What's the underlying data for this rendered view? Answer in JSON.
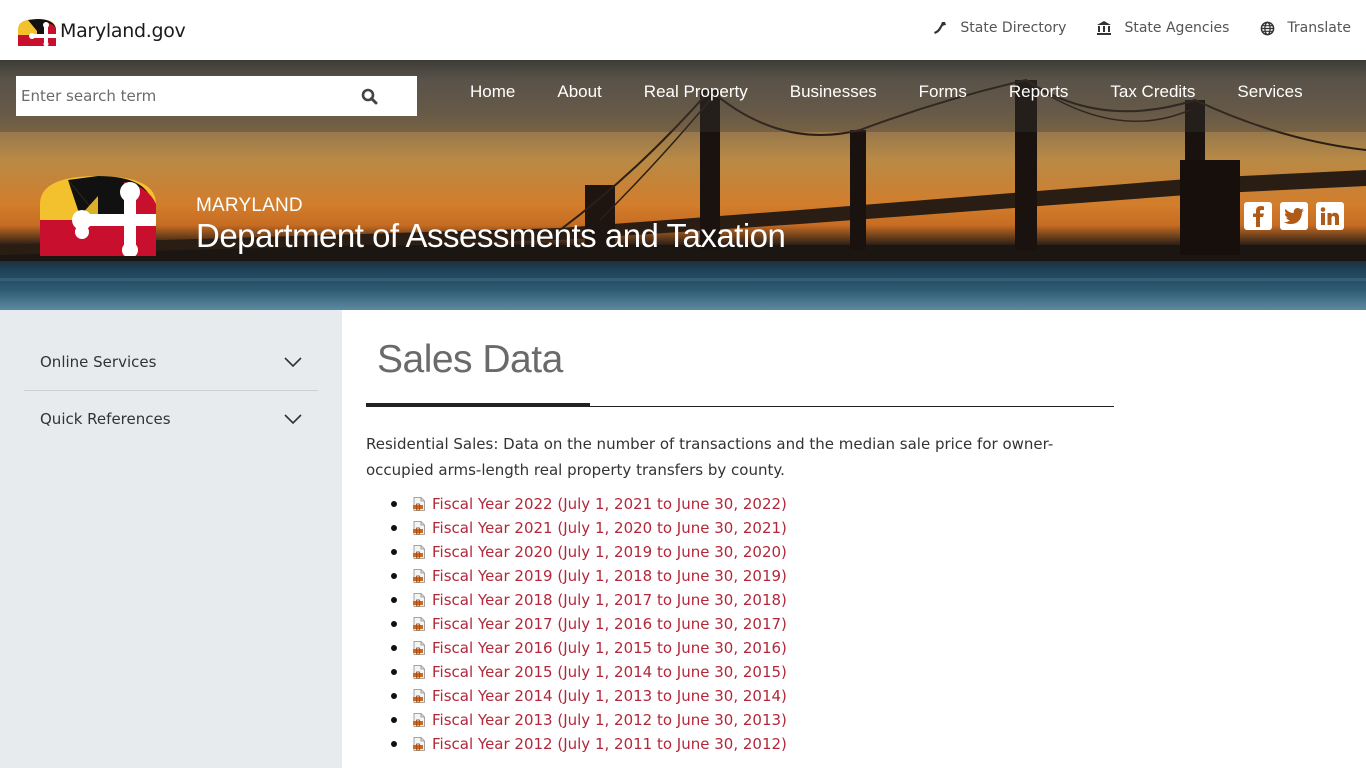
{
  "topbar": {
    "brand": "Maryland.gov",
    "links": [
      {
        "label": "State Directory",
        "icon": "phone-icon"
      },
      {
        "label": "State Agencies",
        "icon": "bank-building-icon"
      },
      {
        "label": "Translate",
        "icon": "globe-icon"
      }
    ]
  },
  "search": {
    "placeholder": "Enter search term",
    "value": ""
  },
  "nav": {
    "items": [
      "Home",
      "About",
      "Real Property",
      "Businesses",
      "Forms",
      "Reports",
      "Tax Credits",
      "Services"
    ]
  },
  "agency": {
    "state": "MARYLAND",
    "name": "Department of Assessments and Taxation"
  },
  "social": [
    "facebook-icon",
    "twitter-icon",
    "linkedin-icon"
  ],
  "sidebar": {
    "items": [
      {
        "label": "Online Services"
      },
      {
        "label": "Quick References"
      }
    ]
  },
  "main": {
    "title": "Sales Data",
    "intro": "Residential Sales: Data on the number of transactions and the median sale price for owner-occupied arms-length real property transfers by county.",
    "links": [
      "Fiscal Year 2022 (July 1, 2021 to June 30, 2022)",
      "Fiscal Year 2021 (July 1, 2020 to June 30, 2021)",
      "Fiscal Year 2020 (July 1, 2019 to June 30, 2020)",
      "Fiscal Year 2019 (July 1, 2018 to June 30, 2019)",
      "Fiscal Year 2018 (July 1, 2017 to June 30, 2018)",
      "Fiscal Year 2017 (July 1, 2016 to June 30, 2017)",
      "Fiscal Year 2016 (July 1, 2015 to June 30, 2016)",
      "Fiscal Year 2015 (July 1, 2014 to June 30, 2015)",
      "Fiscal Year 2014 (July 1, 2013 to June 30, 2014)",
      "Fiscal Year 2013 (July 1, 2012 to June 30, 2013)",
      "Fiscal Year 2012 (July 1, 2011 to June 30, 2012)"
    ]
  },
  "colors": {
    "link": "#b3273a",
    "sidebar_bg": "#e8ebee",
    "flag_gold": "#f3c12d",
    "flag_red": "#c8102e"
  }
}
